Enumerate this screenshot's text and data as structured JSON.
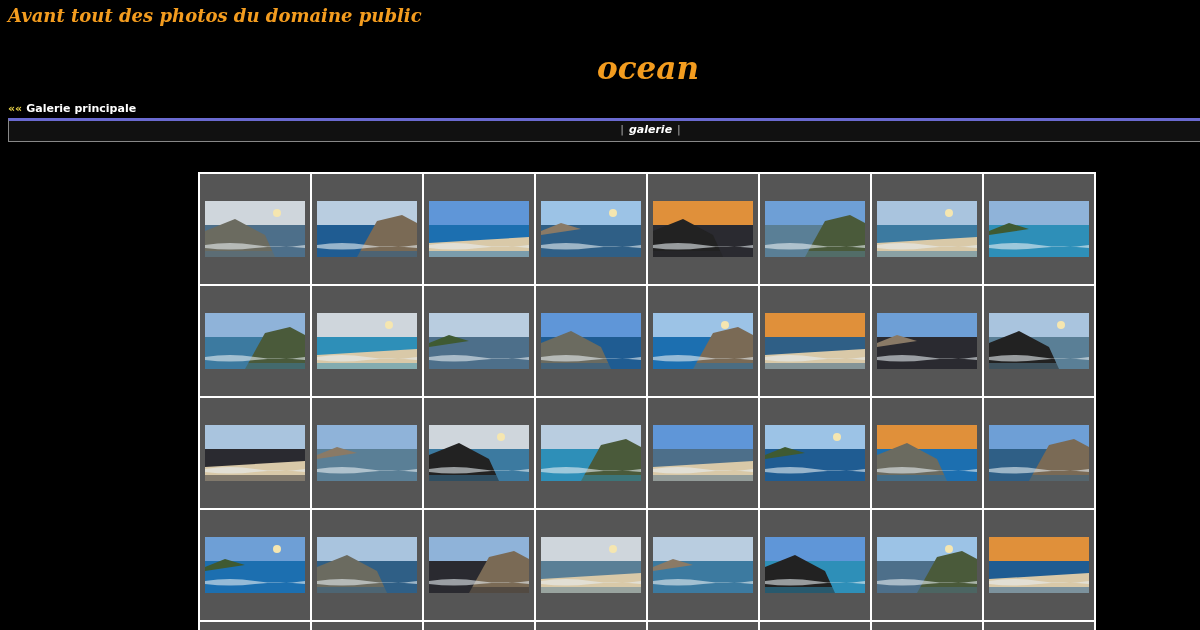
{
  "site_title": "Avant tout des photos du domaine public",
  "heading": "ocean",
  "back_link": {
    "arrows": "««",
    "label": "Galerie principale"
  },
  "nav": {
    "prefix": "|",
    "label": "galerie",
    "suffix": "|"
  }
}
